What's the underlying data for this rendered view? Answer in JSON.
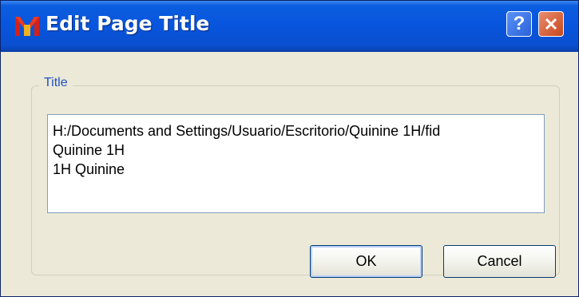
{
  "window": {
    "title": "Edit Page Title",
    "app_icon": "mnova-app-icon",
    "help_icon": "help-icon",
    "close_icon": "close-icon",
    "help_glyph": "?"
  },
  "group": {
    "label": "Title"
  },
  "title_field": {
    "lines": [
      "H:/Documents and Settings/Usuario/Escritorio/Quinine 1H/fid",
      "Quinine 1H",
      "1H Quinine"
    ]
  },
  "buttons": {
    "ok_label": "OK",
    "cancel_label": "Cancel"
  },
  "colors": {
    "titlebar": "#0855dd",
    "window_bg": "#ece9d8",
    "group_label": "#1f4fbf",
    "close_button": "#c7461c",
    "app_icon": "#d4201a"
  }
}
